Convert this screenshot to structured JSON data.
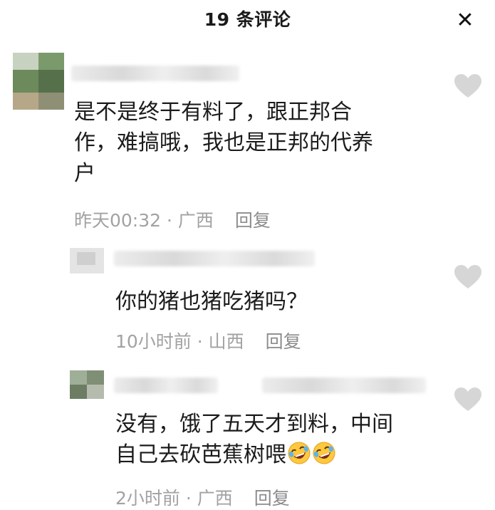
{
  "header": {
    "title": "19 条评论",
    "close_icon": "close-icon"
  },
  "comments": [
    {
      "text_lines": [
        "是不是终于有料了，跟正邦合",
        "作，难搞哦，我也是正邦的代养",
        "户"
      ],
      "time": "昨天00:32",
      "location": "广西",
      "reply": "回复"
    },
    {
      "text_lines": [
        "你的猪也猪吃猪吗？"
      ],
      "time": "10小时前",
      "location": "山西",
      "reply": "回复"
    },
    {
      "text_lines": [
        "没有，饿了五天才到料，中间",
        "自己去砍芭蕉树喂"
      ],
      "emojis": [
        "rofl-emoji",
        "rofl-emoji"
      ],
      "time": "2小时前",
      "location": "广西",
      "reply": "回复"
    }
  ],
  "separator": " · ",
  "colors": {
    "text": "#1b1b1b",
    "meta": "#a2a2a2",
    "heart": "#d6d6d6"
  }
}
